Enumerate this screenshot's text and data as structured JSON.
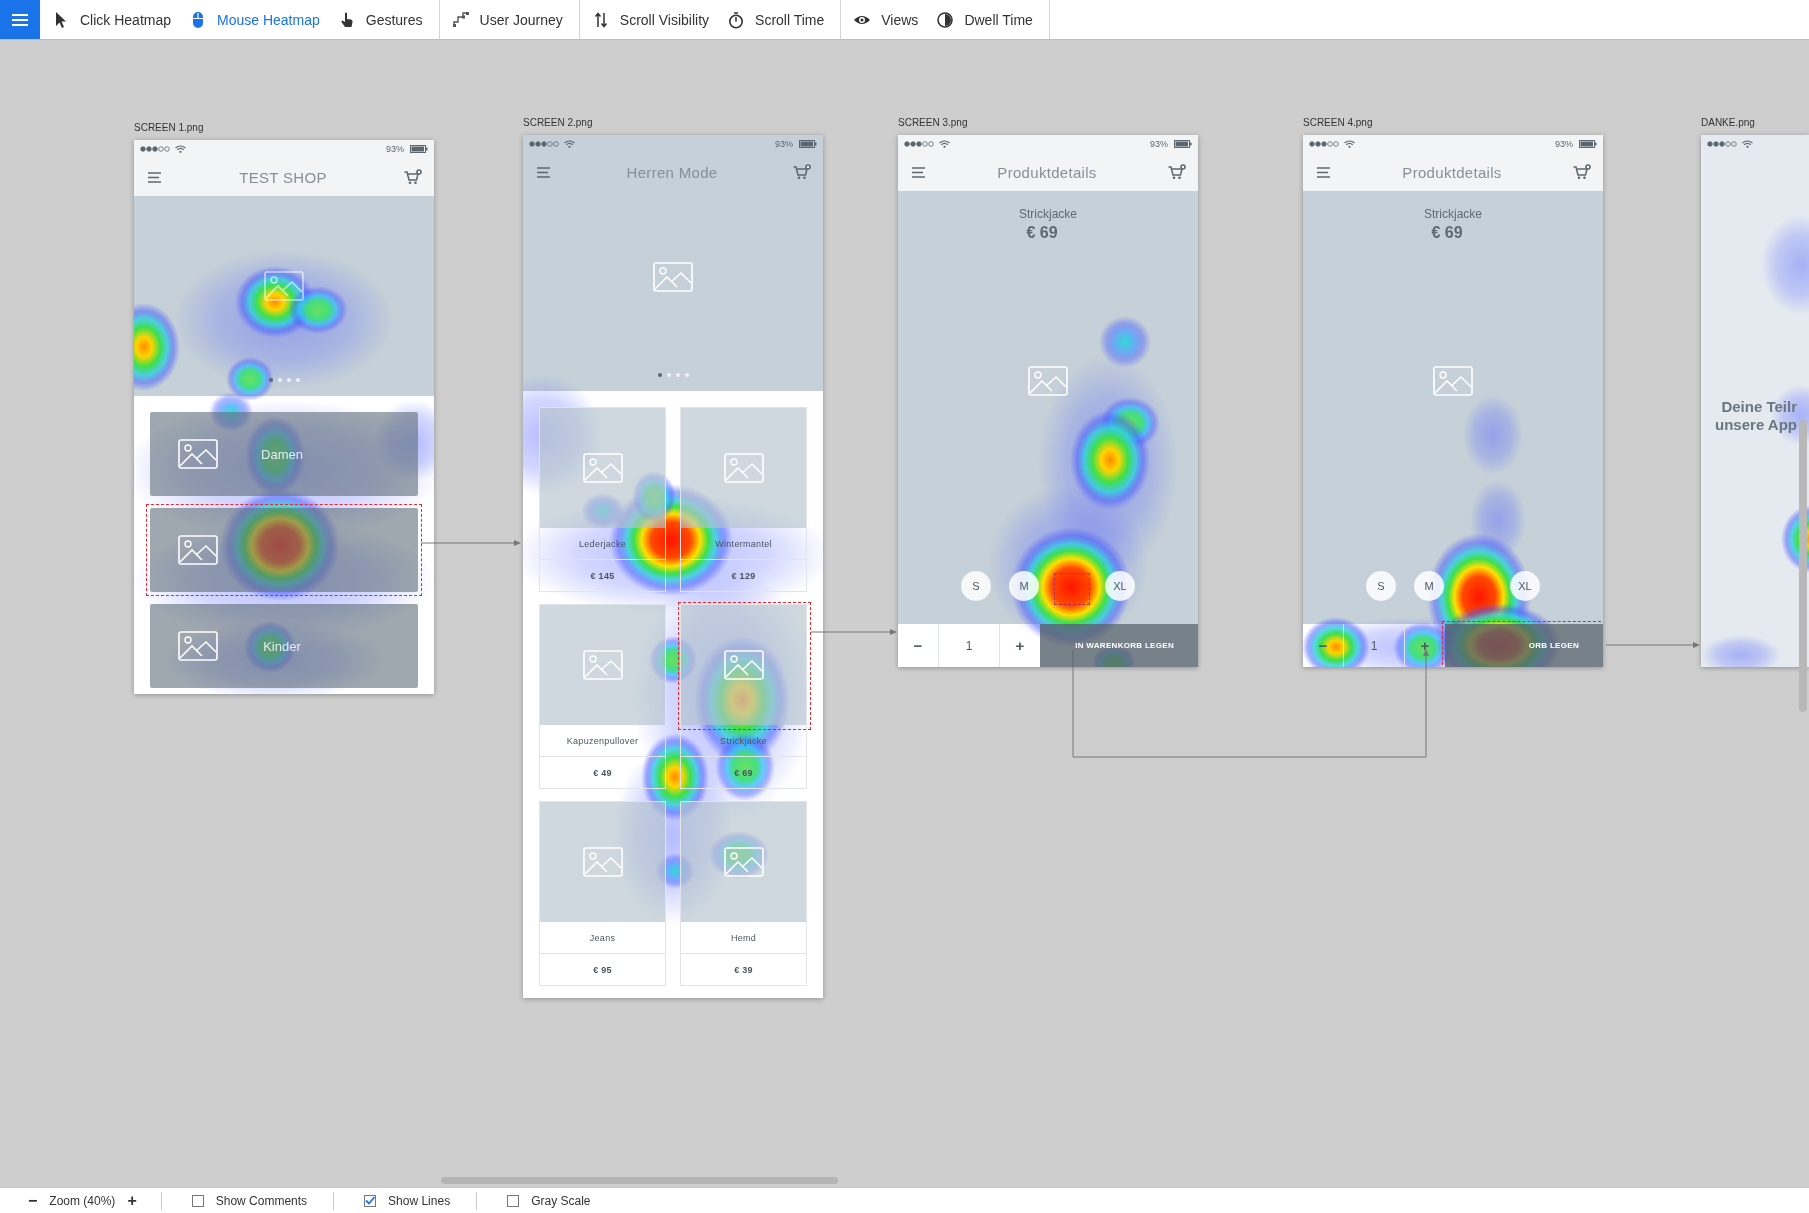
{
  "toolbar": {
    "groups": [
      [
        {
          "label": "Click Heatmap",
          "selected": false
        },
        {
          "label": "Mouse Heatmap",
          "selected": true
        },
        {
          "label": "Gestures",
          "selected": false
        }
      ],
      [
        {
          "label": "User Journey",
          "selected": false
        }
      ],
      [
        {
          "label": "Scroll Visibility",
          "selected": false
        },
        {
          "label": "Scroll Time",
          "selected": false
        }
      ],
      [
        {
          "label": "Views",
          "selected": false
        },
        {
          "label": "Dwell Time",
          "selected": false
        }
      ]
    ]
  },
  "screens": [
    {
      "label": "SCREEN 1.png",
      "kind": "categories",
      "battery": "93%",
      "title": "TEST SHOP",
      "dots": [
        {
          "selected": true
        },
        {
          "selected": false
        },
        {
          "selected": false
        },
        {
          "selected": false
        }
      ],
      "cards": [
        {
          "label": "Damen",
          "highlighted": false
        },
        {
          "highlighted": true
        },
        {
          "label": "Kinder",
          "highlighted": false
        }
      ]
    },
    {
      "label": "SCREEN 2.png",
      "kind": "grid",
      "battery": "93%",
      "title": "Herren Mode",
      "dots": [
        {
          "selected": true
        },
        {
          "selected": false
        },
        {
          "selected": false
        },
        {
          "selected": false
        }
      ],
      "products": [
        {
          "name": "Lederjacke",
          "price": "€ 145",
          "highlighted": false
        },
        {
          "name": "Wintermantel",
          "price": "€ 129",
          "highlighted": false
        },
        {
          "name": "Kapuzenpullover",
          "price": "€ 49",
          "highlighted": false
        },
        {
          "name": "Strickjacke",
          "price": "€ 69",
          "highlighted": true
        },
        {
          "name": "Jeans",
          "price": "€ 95",
          "highlighted": false
        },
        {
          "name": "Hemd",
          "price": "€ 39",
          "highlighted": false
        }
      ]
    },
    {
      "label": "SCREEN 3.png",
      "kind": "detail",
      "battery": "93%",
      "title": "Produktdetails",
      "product": "Strickjacke",
      "price": "€ 69",
      "sizes": [
        {
          "kind": "size",
          "label": "S"
        },
        {
          "kind": "size",
          "label": "M"
        },
        {
          "kind": "hidden",
          "highlighted": true
        },
        {
          "kind": "size",
          "label": "XL"
        }
      ],
      "quantity": {
        "minus": "−",
        "value": "1",
        "plus": "+"
      },
      "cart_button": {
        "label": "IN WARENKORB LEGEN",
        "highlighted": false
      }
    },
    {
      "label": "SCREEN 4.png",
      "kind": "detail",
      "battery": "93%",
      "title": "Produktdetails",
      "product": "Strickjacke",
      "price": "€ 69",
      "sizes": [
        {
          "kind": "size",
          "label": "S"
        },
        {
          "kind": "size",
          "label": "M"
        },
        {
          "kind": "hidden"
        },
        {
          "kind": "size",
          "label": "XL"
        }
      ],
      "quantity": {
        "minus": "−",
        "value": "1",
        "plus": "+"
      },
      "cart_button": {
        "label": "ORB LEGEN",
        "highlighted": true
      }
    },
    {
      "label": "DANKE.png",
      "kind": "thanks",
      "lines": [
        "Deine Teilr",
        "unsere App"
      ]
    }
  ],
  "bottom_bar": {
    "zoom_out": "−",
    "zoom_label": "Zoom (40%)",
    "zoom_in": "+",
    "toggles": [
      {
        "label": "Show Comments",
        "checked": false
      },
      {
        "label": "Show Lines",
        "checked": true
      },
      {
        "label": "Gray Scale",
        "checked": false
      }
    ]
  }
}
